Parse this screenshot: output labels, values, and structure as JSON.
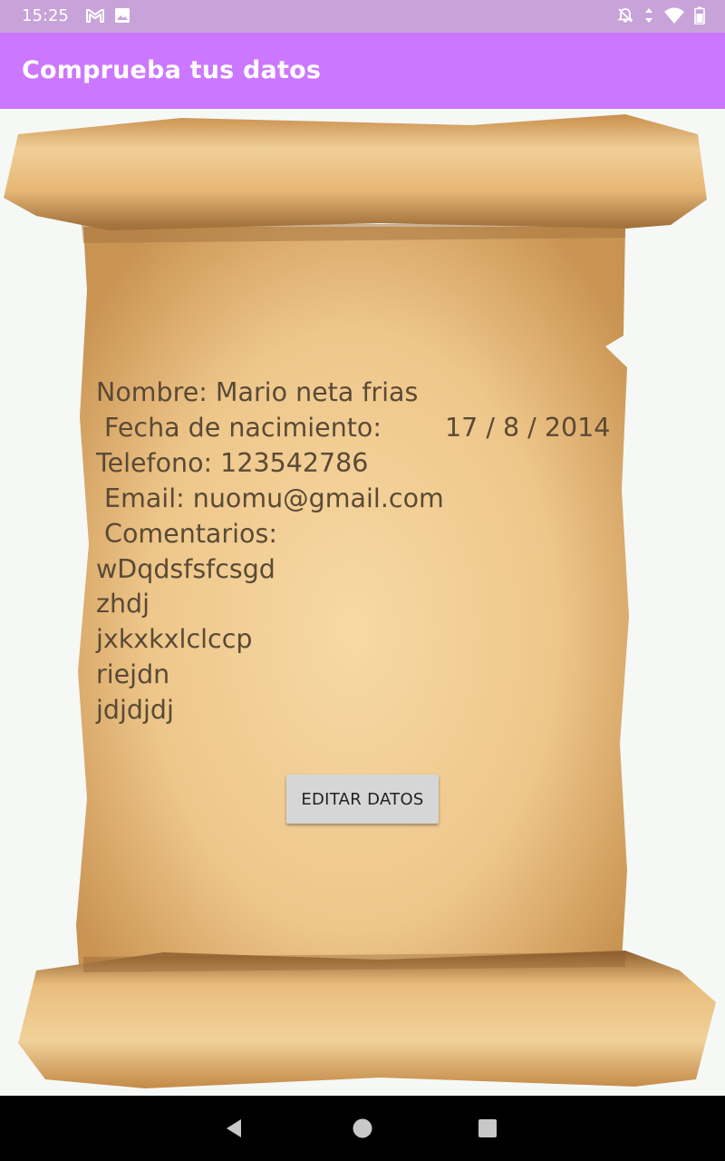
{
  "status_bar": {
    "time": "15:25",
    "left_icons": [
      "gmail-icon",
      "image-icon"
    ],
    "right_icons": [
      "no-alarm-icon",
      "data-arrows-icon",
      "wifi-icon",
      "battery-icon"
    ]
  },
  "app_bar": {
    "title": "Comprueba tus datos",
    "color": "#cc77ff"
  },
  "details": {
    "nombre": "Nombre: Mario neta frias",
    "fecha_label": " Fecha de nacimiento:",
    "fecha_value": "17 / 8 / 2014",
    "telefono": "Telefono: 123542786",
    "email": " Email: nuomu@gmail.com",
    "comentarios_label": " Comentarios:",
    "comentarios": [
      "wDqdsfsfcsgd",
      "zhdj",
      "jxkxkxlclccp",
      "riejdn",
      "jdjdjdj"
    ]
  },
  "edit_button": {
    "label": "EDITAR DATOS"
  },
  "nav_bar": {
    "buttons": [
      "back-icon",
      "home-icon",
      "recents-icon"
    ]
  }
}
